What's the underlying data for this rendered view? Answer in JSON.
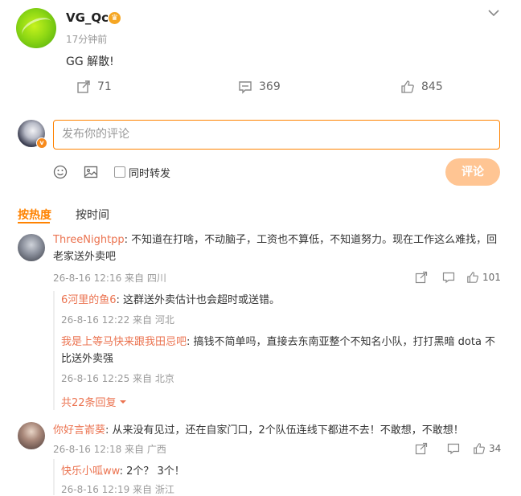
{
  "post": {
    "username": "VG_Qc",
    "time": "17分钟前",
    "text": "GG 解散!",
    "reposts": "71",
    "comments": "369",
    "likes": "845"
  },
  "composer": {
    "placeholder": "发布你的评论",
    "repost_label": "同时转发",
    "submit_label": "评论"
  },
  "sort": {
    "hot": "按热度",
    "time": "按时间"
  },
  "comments": [
    {
      "author": "ThreeNightpp",
      "text_line1": ": 不知道在打啥，不动脑子，工资也不算低，不知道努力。现在工作这么难找，回",
      "text_line2": "老家送外卖吧",
      "meta": "26-8-16 12:16 来自 四川",
      "likes": "101",
      "replies": [
        {
          "author": "6河里的鱼6",
          "text": ": 这群送外卖估计也会超时或送错。",
          "meta": "26-8-16 12:22 来自 河北"
        },
        {
          "author": "我是上等马快来跟我田忌吧",
          "text_line1": ": 搞钱不简单吗，直接去东南亚整个不知名小队，打打黑暗 dota 不",
          "text_line2": "比送外卖强",
          "meta": "26-8-16 12:25 来自 北京"
        }
      ],
      "more": "共22条回复"
    },
    {
      "author": "你好言嵛葵",
      "text": ": 从来没有见过，还在自家门口，2个队伍连线下都进不去！不敢想，不敢想！",
      "meta": "26-8-16 12:18 来自 广西",
      "likes": "34",
      "replies": [
        {
          "author": "快乐小呱ww",
          "text": ": 2个？ 3个！",
          "meta": "26-8-16 12:19 来自 浙江"
        }
      ]
    }
  ]
}
